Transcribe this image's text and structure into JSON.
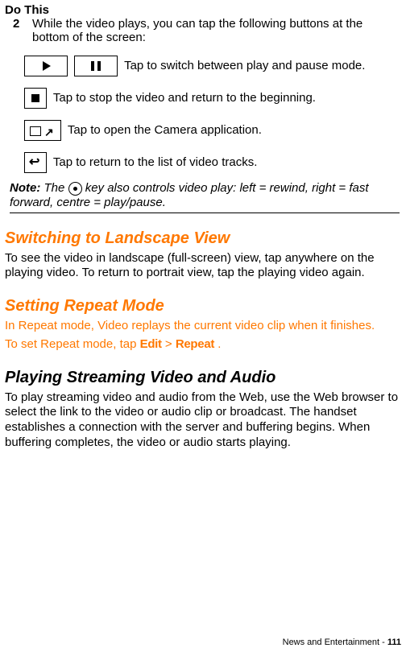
{
  "header": {
    "do_this": "Do This"
  },
  "step": {
    "num": "2",
    "text": "While the video plays, you can tap the following buttons at the bottom of the screen:"
  },
  "icons": {
    "playpause_text": " Tap to switch between play and pause mode.",
    "stop_text": " Tap to stop the video and return to the beginning.",
    "camera_text": " Tap to open the Camera application.",
    "return_text": " Tap to return to the list of video tracks."
  },
  "note": {
    "label": "Note:",
    "before_icon": " The ",
    "after_icon": " key also controls video play: left = rewind, right = fast forward, centre = play/pause."
  },
  "sections": {
    "landscape": {
      "title": "Switching to Landscape View",
      "body": "To see the video in landscape (full-screen) view, tap anywhere on the playing video. To return to portrait view, tap the playing video again."
    },
    "repeat": {
      "title": "Setting Repeat Mode",
      "intro": "In Repeat mode, Video replays the current video clip when it finishes.",
      "set_prefix": "To set Repeat mode, tap ",
      "edit": "Edit",
      "gt": " > ",
      "repeat": "Repeat",
      "period": "."
    },
    "streaming": {
      "title": "Playing Streaming Video and Audio",
      "body": "To play streaming video and audio from the Web, use the Web browser to select the link to the video or audio clip or broadcast. The handset establishes a connection with the server and buffering begins. When buffering completes, the video or audio starts playing."
    }
  },
  "footer": {
    "text": "News and Entertainment - ",
    "page": "111"
  }
}
